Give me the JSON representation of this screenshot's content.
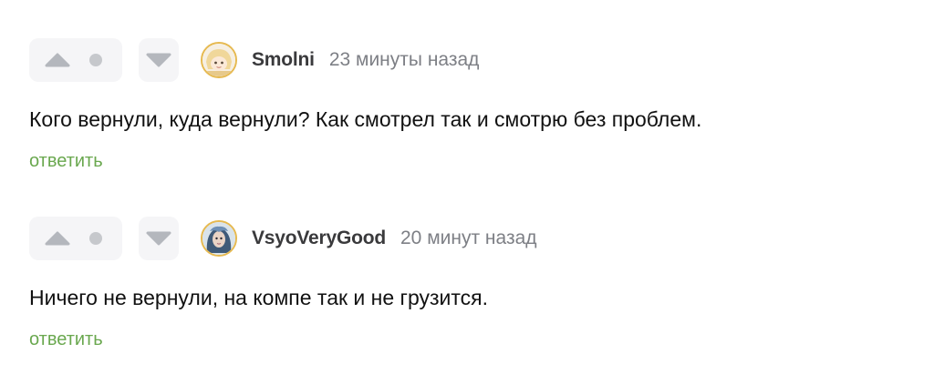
{
  "comments": [
    {
      "username": "Smolni",
      "time": "23 минуты назад",
      "text": "Кого вернули, куда вернули? Как смотрел так и смотрю без проблем.",
      "reply_label": "ответить",
      "avatar_icon": "blonde-girl-avatar"
    },
    {
      "username": "VsyoVeryGood",
      "time": "20 минут назад",
      "text": "Ничего не вернули, на компе так и не грузится.",
      "reply_label": "ответить",
      "avatar_icon": "blue-hair-avatar"
    }
  ],
  "colors": {
    "reply_link": "#6aa84f",
    "vote_background": "#f5f5f7",
    "vote_icon": "#b4b7bd",
    "avatar_border": "#e6b950"
  }
}
